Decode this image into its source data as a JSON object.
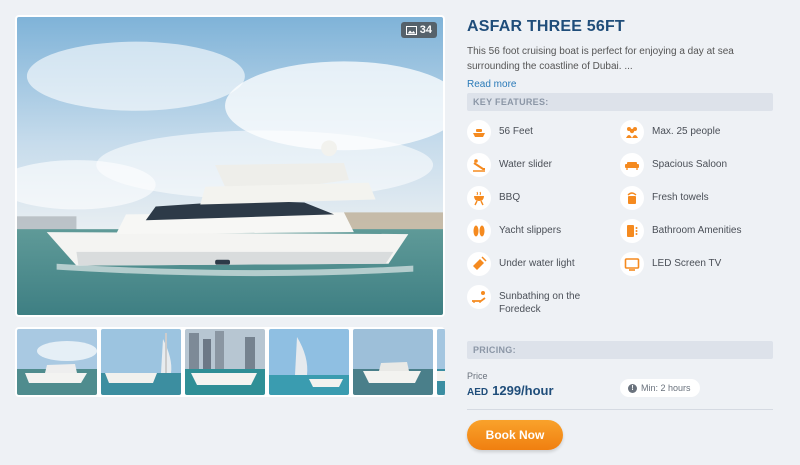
{
  "gallery": {
    "photo_count": "34",
    "thumbnails": [
      "yacht-marina",
      "burj-al-arab-yacht",
      "marina-towers-yacht",
      "burj-al-arab-speedboat",
      "yacht-sea",
      "yacht-partial"
    ]
  },
  "listing": {
    "title": "ASFAR THREE 56FT",
    "description": "This 56 foot cruising boat is perfect for enjoying a day at sea surrounding the coastline of Dubai. ...",
    "read_more": "Read more"
  },
  "features": {
    "heading": "KEY FEATURES:",
    "items": [
      {
        "label": "56 Feet",
        "icon": "boat-icon"
      },
      {
        "label": "Max. 25 people",
        "icon": "people-icon"
      },
      {
        "label": "Water slider",
        "icon": "slider-icon"
      },
      {
        "label": "Spacious Saloon",
        "icon": "sofa-icon"
      },
      {
        "label": "BBQ",
        "icon": "bbq-icon"
      },
      {
        "label": "Fresh towels",
        "icon": "towel-icon"
      },
      {
        "label": "Yacht slippers",
        "icon": "slippers-icon"
      },
      {
        "label": "Bathroom Amenities",
        "icon": "bathroom-icon"
      },
      {
        "label": "Under water light",
        "icon": "flashlight-icon"
      },
      {
        "label": "LED Screen TV",
        "icon": "tv-icon"
      },
      {
        "label": "Sunbathing on the Foredeck",
        "icon": "sunbed-icon"
      }
    ]
  },
  "pricing": {
    "heading": "PRICING:",
    "price_label": "Price",
    "currency": "AED",
    "amount": "1299/hour",
    "min_label": "Min: 2 hours",
    "book_label": "Book Now"
  },
  "colors": {
    "accent": "#f58a1f",
    "title": "#1f4d7a",
    "link": "#2a7ab8",
    "section_bg": "#dde2ea"
  }
}
